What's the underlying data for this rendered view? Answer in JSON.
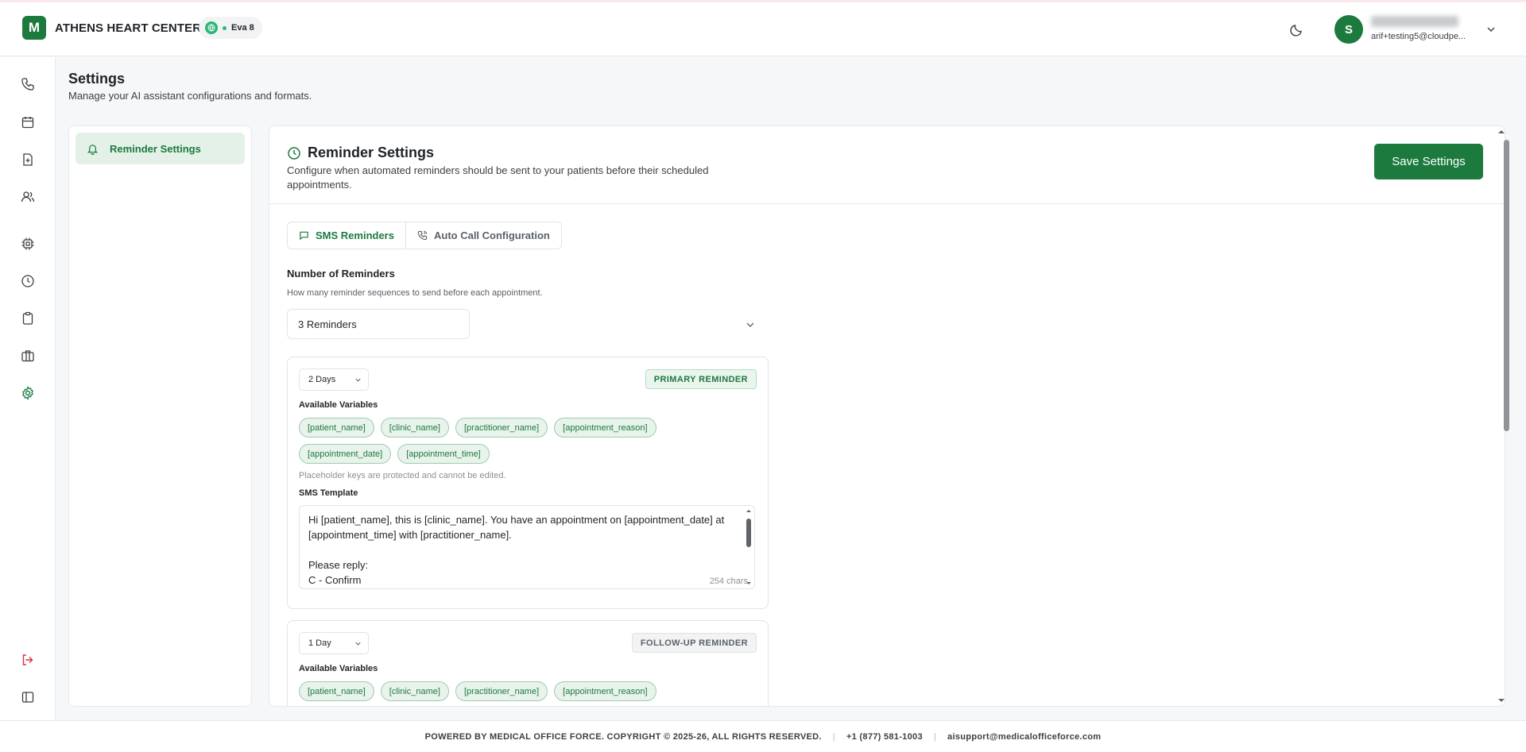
{
  "header": {
    "logo_letter": "M",
    "brand": "ATHENS HEART CENTER",
    "assistant_chip": "Eva 8",
    "avatar_letter": "S",
    "user_email": "arif+testing5@cloudpe...",
    "accent_color": "#1c7a3f"
  },
  "sidebar": {
    "items": [
      {
        "icon": "phone-icon"
      },
      {
        "icon": "calendar-icon"
      },
      {
        "icon": "file-plus-icon"
      },
      {
        "icon": "users-icon"
      },
      {
        "icon": "cpu-icon"
      },
      {
        "icon": "clock-icon"
      },
      {
        "icon": "clipboard-icon"
      },
      {
        "icon": "briefcase-icon"
      },
      {
        "icon": "gear-icon",
        "active": true
      },
      {
        "icon": "logout-icon"
      },
      {
        "icon": "sidebar-toggle-icon"
      }
    ]
  },
  "page": {
    "title": "Settings",
    "subtitle": "Manage your AI assistant configurations and formats."
  },
  "settings_nav": {
    "items": [
      {
        "label": "Reminder Settings",
        "icon": "bell-icon",
        "active": true
      }
    ]
  },
  "reminder": {
    "title": "Reminder Settings",
    "description": "Configure when automated reminders should be sent to your patients before their scheduled appointments.",
    "save_label": "Save Settings",
    "tabs": [
      {
        "label": "SMS Reminders",
        "icon": "message-icon",
        "active": true
      },
      {
        "label": "Auto Call Configuration",
        "icon": "phone-call-icon",
        "active": false
      }
    ],
    "count_label": "Number of Reminders",
    "count_hint": "How many reminder sequences to send before each appointment.",
    "count_value": "3 Reminders",
    "cards": [
      {
        "timing": "2 Days",
        "badge": "PRIMARY REMINDER",
        "variables_label": "Available Variables",
        "variables": [
          "[patient_name]",
          "[clinic_name]",
          "[practitioner_name]",
          "[appointment_reason]",
          "[appointment_date]",
          "[appointment_time]"
        ],
        "protected_note": "Placeholder keys are protected and cannot be edited.",
        "template_label": "SMS Template",
        "template_text": "Hi [patient_name], this is [clinic_name]. You have an appointment on [appointment_date] at [appointment_time] with [practitioner_name].\n\nPlease reply:\nC - Confirm",
        "char_count": "254 chars"
      },
      {
        "timing": "1 Day",
        "badge": "FOLLOW-UP REMINDER",
        "variables_label": "Available Variables",
        "variables": [
          "[patient_name]",
          "[clinic_name]",
          "[practitioner_name]",
          "[appointment_reason]"
        ]
      }
    ]
  },
  "footer": {
    "copyright": "POWERED BY MEDICAL OFFICE FORCE. COPYRIGHT © 2025-26, ALL RIGHTS RESERVED.",
    "phone": "+1 (877) 581-1003",
    "email": "aisupport@medicalofficeforce.com"
  }
}
